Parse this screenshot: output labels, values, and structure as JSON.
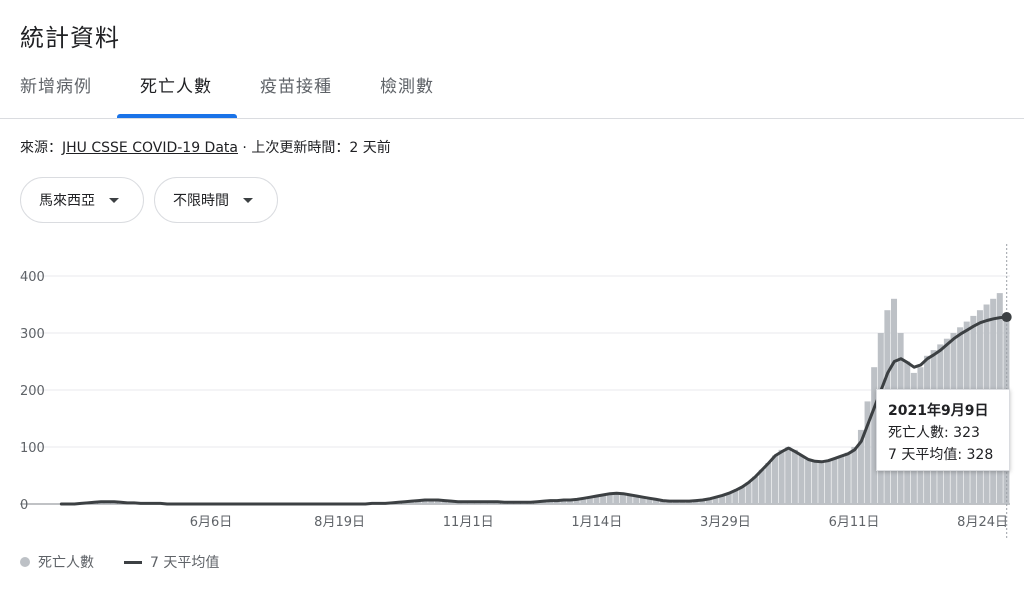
{
  "page": {
    "title": "統計資料"
  },
  "tabs": [
    {
      "label": "新增病例"
    },
    {
      "label": "死亡人數"
    },
    {
      "label": "疫苗接種"
    },
    {
      "label": "檢測數"
    }
  ],
  "source": {
    "prefix": "來源：",
    "link": "JHU CSSE COVID-19 Data",
    "suffix": " · 上次更新時間：2 天前"
  },
  "filters": {
    "region": "馬來西亞",
    "time": "不限時間"
  },
  "tooltip": {
    "date": "2021年9月9日",
    "deaths_label": "死亡人數: 323",
    "avg_label": "7 天平均值: 328"
  },
  "legend": {
    "bars": "死亡人數",
    "line": "7 天平均值"
  },
  "colors": {
    "accent": "#1a73e8",
    "bar": "#bdc1c6",
    "line": "#3c4043"
  },
  "chart_data": {
    "type": "bar",
    "title": "",
    "xlabel": "",
    "ylabel": "",
    "ylim": [
      0,
      400
    ],
    "yticks": [
      0,
      100,
      200,
      300,
      400
    ],
    "x_tick_labels": [
      "6月6日",
      "8月19日",
      "11月1日",
      "1月14日",
      "3月29日",
      "6月11日",
      "8月24日"
    ],
    "grid": true,
    "legend_position": "bottom-left",
    "series": [
      {
        "name": "死亡人數",
        "type": "bar",
        "values": [
          0,
          0,
          0,
          1,
          2,
          3,
          4,
          5,
          4,
          3,
          2,
          2,
          1,
          1,
          1,
          1,
          0,
          0,
          0,
          0,
          0,
          0,
          0,
          0,
          0,
          0,
          0,
          0,
          0,
          0,
          0,
          0,
          0,
          0,
          0,
          0,
          0,
          0,
          0,
          0,
          0,
          0,
          0,
          0,
          0,
          0,
          0,
          1,
          1,
          1,
          2,
          3,
          4,
          5,
          6,
          7,
          8,
          7,
          6,
          5,
          4,
          4,
          4,
          4,
          4,
          5,
          4,
          3,
          4,
          3,
          3,
          3,
          4,
          5,
          6,
          6,
          7,
          7,
          8,
          10,
          12,
          14,
          16,
          18,
          20,
          18,
          16,
          14,
          12,
          10,
          8,
          6,
          5,
          5,
          5,
          5,
          6,
          7,
          9,
          12,
          15,
          19,
          24,
          30,
          38,
          48,
          60,
          72,
          85,
          95,
          100,
          95,
          85,
          78,
          75,
          74,
          76,
          80,
          85,
          90,
          100,
          130,
          180,
          240,
          300,
          340,
          360,
          300,
          250,
          230,
          240,
          260,
          270,
          280,
          290,
          300,
          310,
          320,
          330,
          340,
          350,
          360,
          370,
          323
        ]
      },
      {
        "name": "7 天平均值",
        "type": "line",
        "values": [
          0,
          0,
          0,
          1,
          2,
          3,
          4,
          4,
          4,
          3,
          2,
          2,
          1,
          1,
          1,
          1,
          0,
          0,
          0,
          0,
          0,
          0,
          0,
          0,
          0,
          0,
          0,
          0,
          0,
          0,
          0,
          0,
          0,
          0,
          0,
          0,
          0,
          0,
          0,
          0,
          0,
          0,
          0,
          0,
          0,
          0,
          0,
          1,
          1,
          1,
          2,
          3,
          4,
          5,
          6,
          7,
          7,
          7,
          6,
          5,
          4,
          4,
          4,
          4,
          4,
          4,
          4,
          3,
          3,
          3,
          3,
          3,
          4,
          5,
          6,
          6,
          7,
          7,
          8,
          10,
          12,
          14,
          16,
          18,
          19,
          18,
          16,
          14,
          12,
          10,
          8,
          6,
          5,
          5,
          5,
          5,
          6,
          7,
          9,
          12,
          15,
          19,
          24,
          30,
          38,
          48,
          60,
          72,
          85,
          92,
          98,
          92,
          85,
          78,
          75,
          74,
          76,
          80,
          84,
          88,
          95,
          110,
          140,
          170,
          200,
          230,
          250,
          255,
          248,
          240,
          244,
          255,
          262,
          270,
          280,
          290,
          298,
          305,
          312,
          318,
          322,
          325,
          327,
          328
        ]
      }
    ]
  }
}
